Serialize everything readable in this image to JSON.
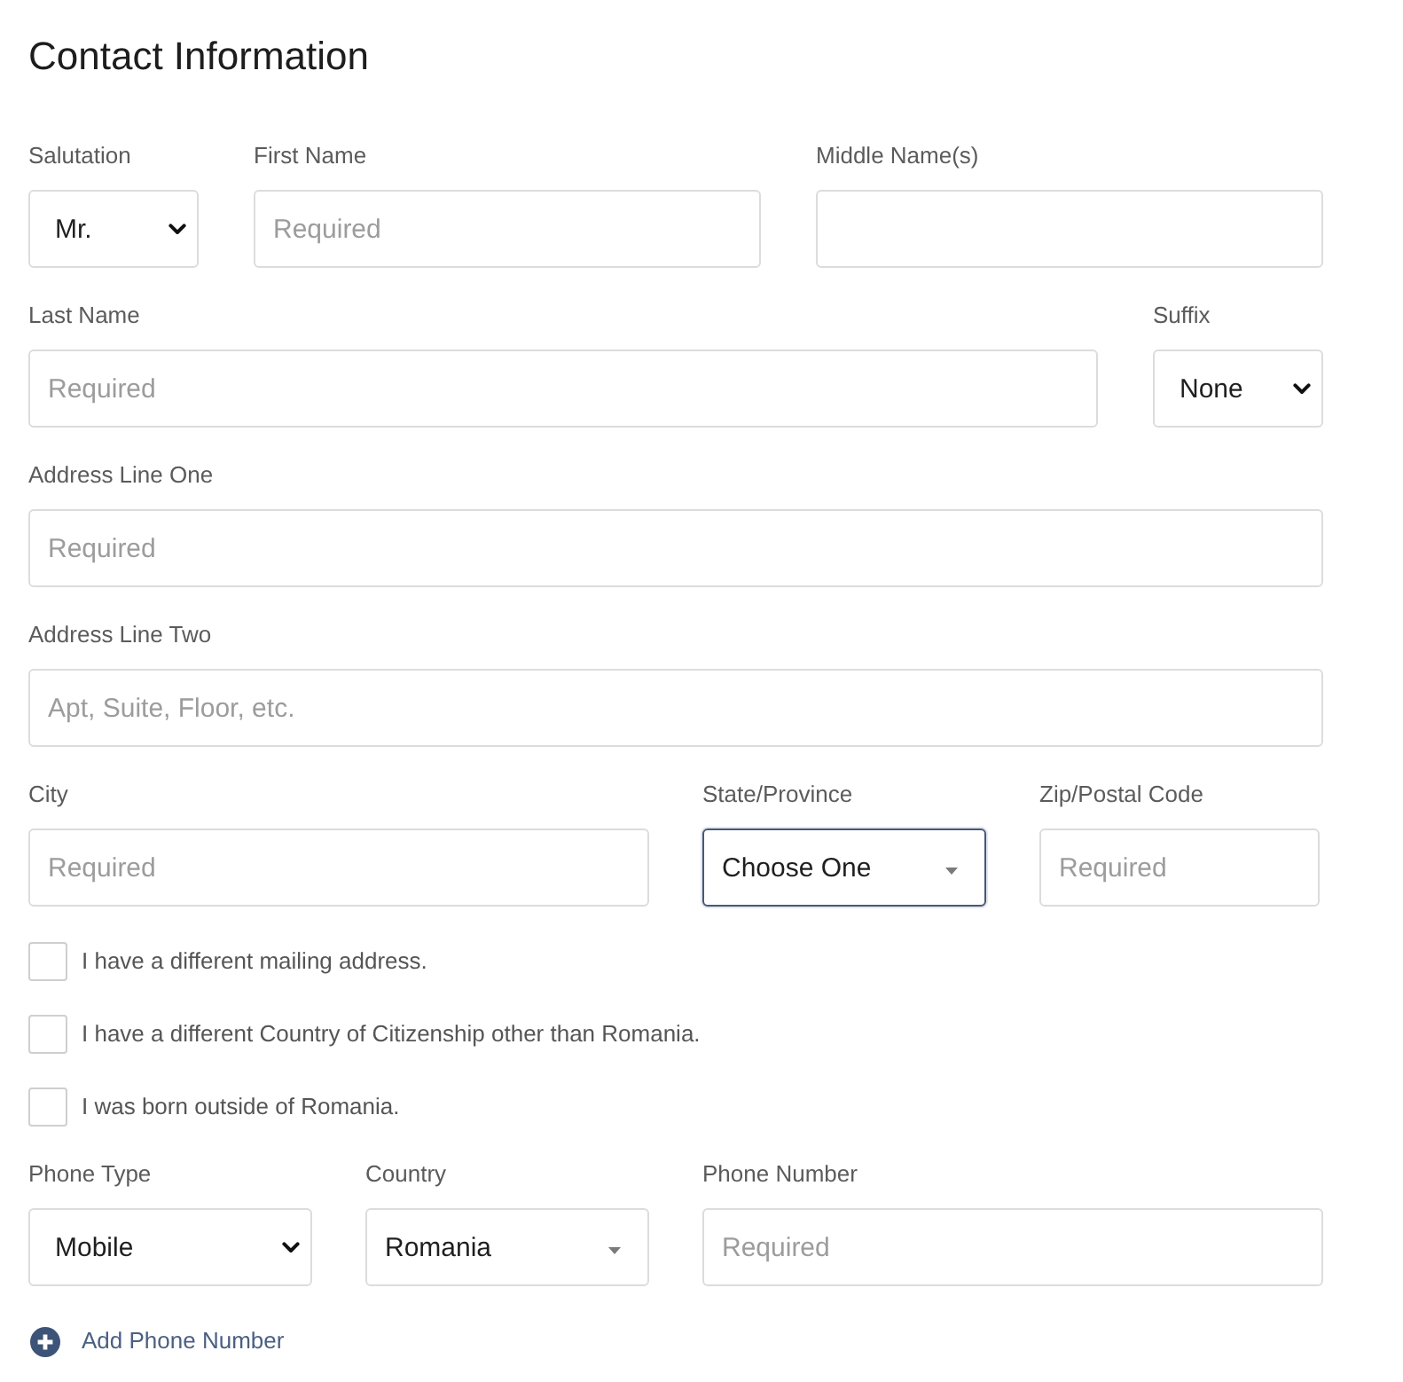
{
  "title": "Contact Information",
  "rows": [
    {
      "fields": [
        {
          "kind": "select",
          "label": "Salutation",
          "value": "Mr.",
          "focused": false
        },
        {
          "kind": "text",
          "label": "First Name",
          "placeholder": "Required",
          "focused": false
        },
        {
          "kind": "text",
          "label": "Middle Name(s)",
          "focused": false
        }
      ]
    },
    {
      "fields": [
        {
          "kind": "text",
          "label": "Last Name",
          "placeholder": "Required",
          "focused": false
        },
        {
          "kind": "select",
          "label": "Suffix",
          "value": "None",
          "focused": false
        }
      ]
    },
    {
      "fields": [
        {
          "kind": "text",
          "label": "Address Line One",
          "placeholder": "Required",
          "focused": false
        }
      ]
    },
    {
      "fields": [
        {
          "kind": "text",
          "label": "Address Line Two",
          "placeholder": "Apt, Suite, Floor, etc.",
          "focused": false
        }
      ]
    },
    {
      "fields": [
        {
          "kind": "text",
          "label": "City",
          "placeholder": "Required",
          "focused": false
        },
        {
          "kind": "dropdown",
          "label": "State/Province",
          "value": "Choose One",
          "focused": true
        },
        {
          "kind": "text",
          "label": "Zip/Postal Code",
          "placeholder": "Required",
          "focused": false
        }
      ]
    }
  ],
  "checkboxes": [
    {
      "label": "I have a different mailing address.",
      "checked": false
    },
    {
      "label": "I have a different Country of Citizenship other than Romania.",
      "checked": false
    },
    {
      "label": "I was born outside of Romania.",
      "checked": false
    }
  ],
  "phone_row": {
    "fields": [
      {
        "kind": "select",
        "label": "Phone Type",
        "value": "Mobile",
        "focused": false
      },
      {
        "kind": "dropdown",
        "label": "Country",
        "value": "Romania",
        "focused": false
      },
      {
        "kind": "text",
        "label": "Phone Number",
        "placeholder": "Required",
        "focused": false
      }
    ]
  },
  "add_phone": {
    "label": "Add Phone Number"
  }
}
